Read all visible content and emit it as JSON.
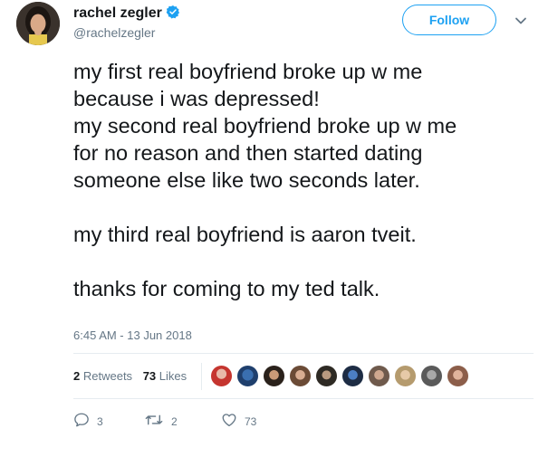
{
  "author": {
    "display_name": "rachel zegler",
    "handle": "@rachelzegler",
    "verified": true
  },
  "follow_button": {
    "label": "Follow"
  },
  "tweet": {
    "text": "my first real boyfriend broke up w me\nbecause i was depressed!\nmy second real boyfriend broke up w me\nfor no reason and then started dating\nsomeone else like two seconds later.\n\nmy third real boyfriend is aaron tveit.\n\nthanks for coming to my ted talk.",
    "timestamp": "6:45 AM - 13 Jun 2018"
  },
  "stats": {
    "retweets_count": "2",
    "retweets_label": "Retweets",
    "likes_count": "73",
    "likes_label": "Likes"
  },
  "actions": {
    "reply_count": "3",
    "retweet_count": "2",
    "like_count": "73"
  },
  "colors": {
    "accent": "#1da1f2",
    "muted": "#657786",
    "text": "#14171a",
    "divider": "#e6ecf0"
  },
  "icons": [
    "verified-badge-icon",
    "chevron-down-icon",
    "reply-icon",
    "retweet-icon",
    "heart-icon"
  ]
}
